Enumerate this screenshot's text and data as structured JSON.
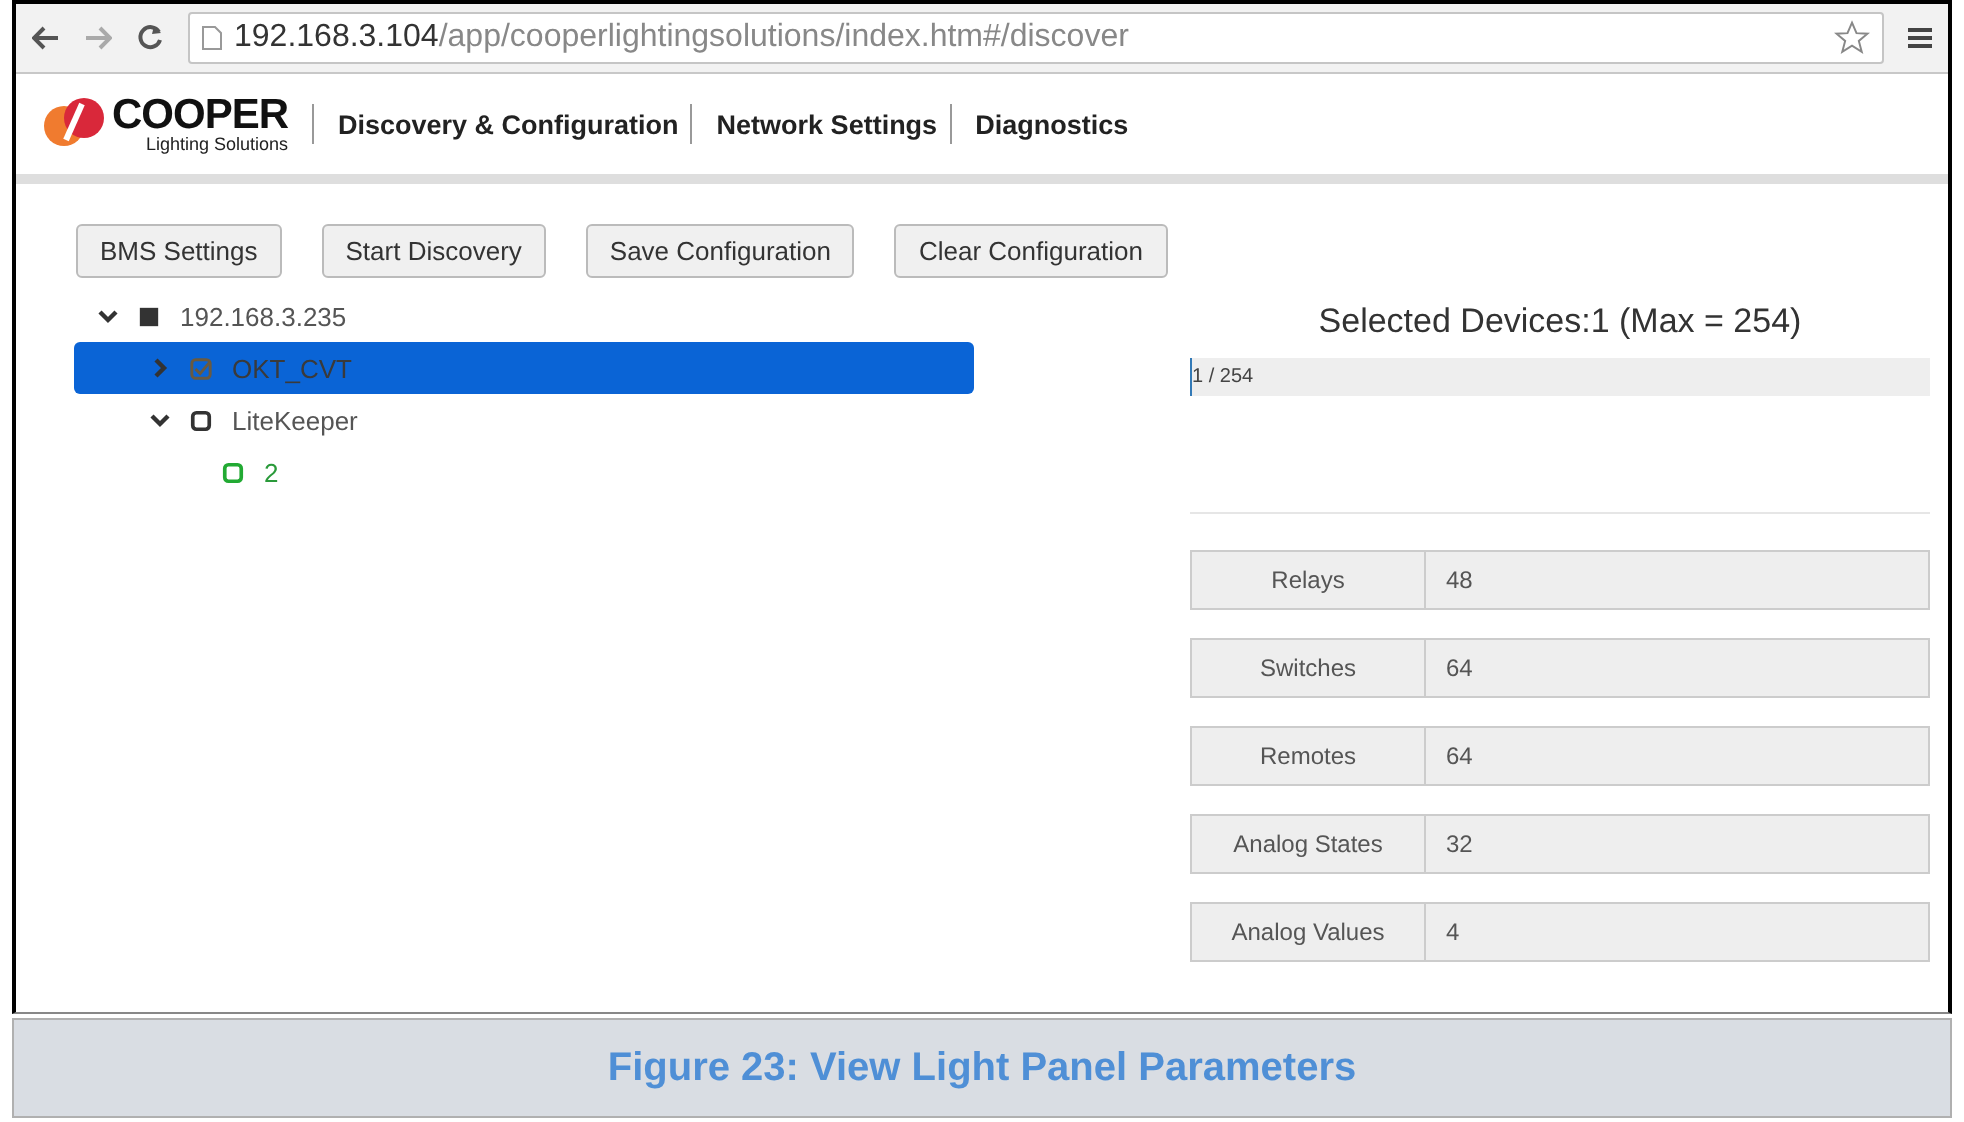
{
  "browser": {
    "url_host": "192.168.3.104",
    "url_path": "/app/cooperlightingsolutions/index.htm#/discover"
  },
  "header": {
    "logo_name": "COOPER",
    "logo_tagline": "Lighting Solutions",
    "nav": [
      {
        "label": "Discovery & Configuration"
      },
      {
        "label": "Network Settings"
      },
      {
        "label": "Diagnostics"
      }
    ]
  },
  "toolbar": [
    "BMS Settings",
    "Start Discovery",
    "Save Configuration",
    "Clear Configuration"
  ],
  "tree": [
    {
      "label": "192.168.3.235",
      "kind": "network",
      "expanded": true,
      "selected": false,
      "children": [
        {
          "label": "OKT_CVT",
          "kind": "controller",
          "expanded": false,
          "selected": true
        },
        {
          "label": "LiteKeeper",
          "kind": "panel",
          "expanded": true,
          "selected": false,
          "children": [
            {
              "label": "2",
              "kind": "zone",
              "selected": false
            }
          ]
        }
      ]
    }
  ],
  "selection": {
    "title": "Selected Devices:1 (Max = 254)",
    "progress_text": "1 / 254",
    "level": 0.004
  },
  "parameters": [
    {
      "label": "Relays",
      "value": "48"
    },
    {
      "label": "Switches",
      "value": "64"
    },
    {
      "label": "Remotes",
      "value": "64"
    },
    {
      "label": "Analog States",
      "value": "32"
    },
    {
      "label": "Analog Values",
      "value": "4"
    }
  ],
  "caption": "Figure 23: View Light Panel Parameters"
}
